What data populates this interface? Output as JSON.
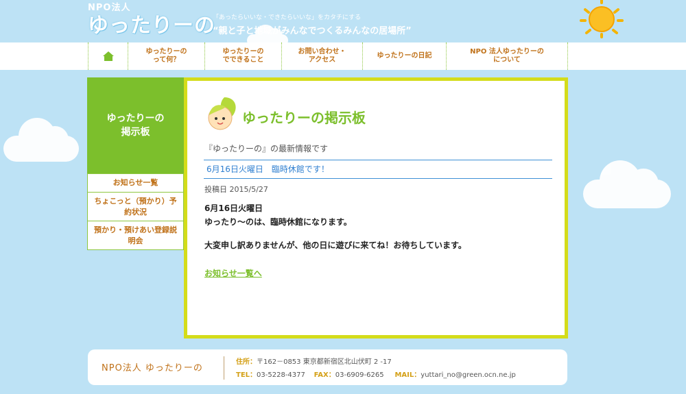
{
  "header": {
    "org_small": "NPO法人",
    "logo_text": "ゆったりーの",
    "tagline_small": "「あったらいいな・できたらいいな」をカタチにする",
    "tagline_main": "“親と子と地域がみんなでつくるみんなの居場所”"
  },
  "nav": {
    "items": [
      {
        "label": "ゆったりーの\nって何？"
      },
      {
        "label": "ゆったりーの\nでできること"
      },
      {
        "label": "お問い合わせ・\nアクセス"
      },
      {
        "label": "ゆったりーの日記"
      },
      {
        "label": "NPO 法人ゆったりーの\nについて"
      }
    ]
  },
  "sidebar": {
    "title": "ゆったりーの\n掲示板",
    "items": [
      {
        "label": "お知らせ一覧"
      },
      {
        "label": "ちょこっと（預かり）予約状況"
      },
      {
        "label": "預かり・預けあい登録説明会"
      }
    ]
  },
  "main": {
    "title": "ゆったりーの掲示板",
    "subtitle": "『ゆったりーの』の最新情報です",
    "post_title": "6月16日火曜日　臨時休館です！",
    "post_date": "投稿日 2015/5/27",
    "body_line1": "6月16日火曜日",
    "body_line2": "ゆったり〜のは、臨時休館になります。",
    "body_line3": "大変申し訳ありませんが、他の日に遊びに来てね！お待ちしています。",
    "back_link": "お知らせ一覧へ"
  },
  "footer": {
    "org_name": "NPO法人 ゆったりーの",
    "addr_label": "住所：",
    "addr_value": "〒162－0853  東京都新宿区北山伏町 2 -17",
    "tel_label": "TEL：",
    "tel_value": "03-5228-4377",
    "fax_label": "FAX：",
    "fax_value": "03-6909-6265",
    "mail_label": "MAIL：",
    "mail_value": "yuttari_no@green.ocn.ne.jp"
  },
  "colors": {
    "sky": "#bde2f5",
    "green": "#7cbf2c",
    "yellow_border": "#d4dc1a",
    "orange_text": "#c0721a",
    "blue_link": "#2f7fd0"
  },
  "icons": {
    "home": "home-icon",
    "sun": "sun-icon",
    "mascot": "mascot-icon"
  }
}
